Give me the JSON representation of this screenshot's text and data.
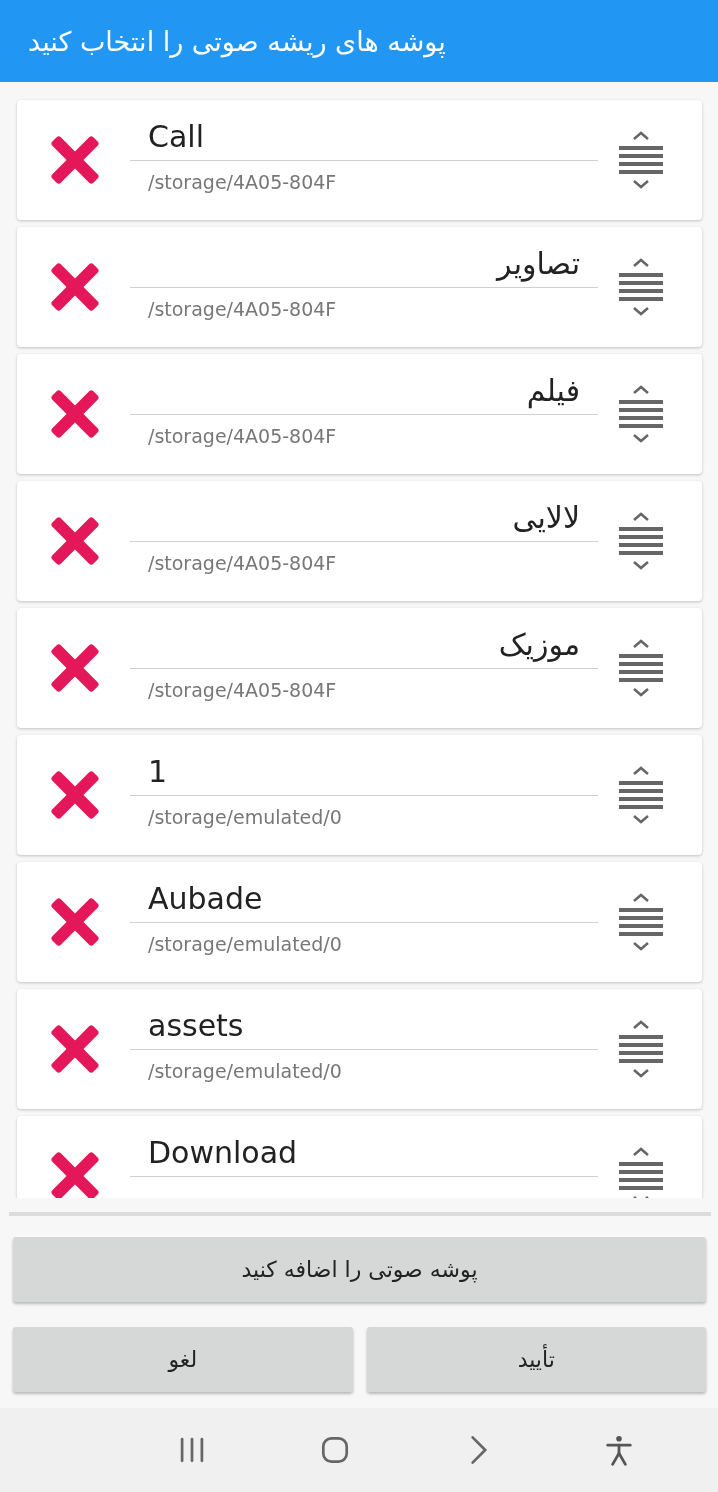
{
  "title": "پوشه های ریشه صوتی را انتخاب کنید",
  "folders": [
    {
      "name": "Call",
      "path": "/storage/4A05-804F"
    },
    {
      "name": "تصاویر",
      "path": "/storage/4A05-804F"
    },
    {
      "name": "فیلم",
      "path": "/storage/4A05-804F"
    },
    {
      "name": "لالایی",
      "path": "/storage/4A05-804F"
    },
    {
      "name": "موزیک",
      "path": "/storage/4A05-804F"
    },
    {
      "name": "1",
      "path": "/storage/emulated/0"
    },
    {
      "name": "Aubade",
      "path": "/storage/emulated/0"
    },
    {
      "name": "assets",
      "path": "/storage/emulated/0"
    },
    {
      "name": "Download"
    }
  ],
  "add_button": "پوشه صوتی را اضافه کنید",
  "cancel_button": "لغو",
  "ok_button": "تأیید"
}
